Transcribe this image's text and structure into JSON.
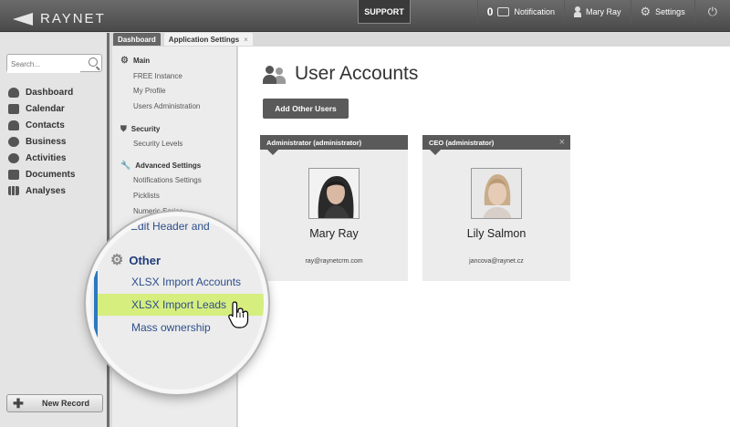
{
  "topbar": {
    "logo": "RAYNET",
    "support": "SUPPORT",
    "notification_count": "0",
    "notification_label": "Notification",
    "user_name": "Mary Ray",
    "settings_label": "Settings"
  },
  "sidebar": {
    "search_placeholder": "Search...",
    "items": [
      {
        "label": "Dashboard",
        "icon": "cloud-icon"
      },
      {
        "label": "Calendar",
        "icon": "calendar-icon"
      },
      {
        "label": "Contacts",
        "icon": "person-icon"
      },
      {
        "label": "Business",
        "icon": "dollar-icon"
      },
      {
        "label": "Activities",
        "icon": "clock-icon"
      },
      {
        "label": "Documents",
        "icon": "stack-icon"
      },
      {
        "label": "Analyses",
        "icon": "bar-chart-icon"
      }
    ],
    "new_record": "New Record"
  },
  "tabs": [
    {
      "label": "Dashboard",
      "active": false
    },
    {
      "label": "Application Settings",
      "active": true,
      "close": "×"
    }
  ],
  "settings_menu": {
    "main": {
      "title": "Main",
      "items": [
        "FREE Instance",
        "My Profile",
        "Users Administration"
      ]
    },
    "security": {
      "title": "Security",
      "items": [
        "Security Levels"
      ]
    },
    "advanced": {
      "title": "Advanced Settings",
      "items": [
        "Notifications Settings",
        "Picklists",
        "Numeric Series"
      ]
    }
  },
  "main": {
    "title": "User Accounts",
    "add_button": "Add Other Users",
    "cards": [
      {
        "role": "Administrator (administrator)",
        "name": "Mary Ray",
        "email": "ray@raynetcrm.com",
        "closable": false
      },
      {
        "role": "CEO (administrator)",
        "name": "Lily Salmon",
        "email": "jancova@raynet.cz",
        "closable": true,
        "close": "×"
      }
    ]
  },
  "magnifier": {
    "cut_text": "Edit Header and",
    "section": "Other",
    "items": [
      "XLSX Import Accounts",
      "XLSX Import Leads",
      "Mass ownership"
    ],
    "highlighted": "XLSX Import Leads",
    "highlight_color": "#d6ee7e"
  }
}
